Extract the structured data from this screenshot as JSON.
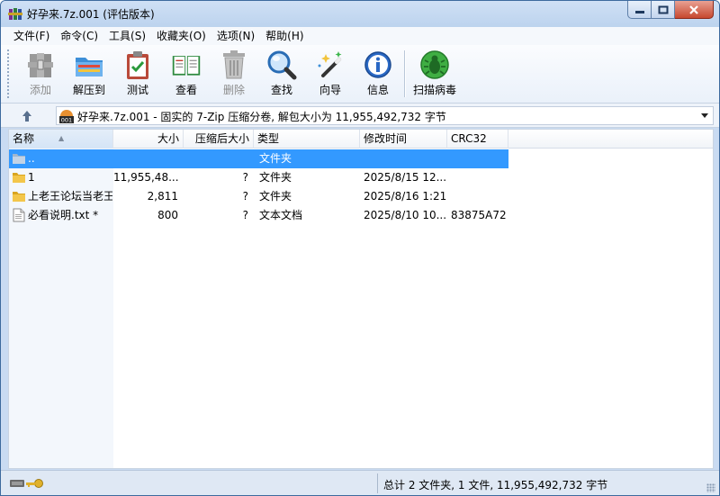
{
  "window": {
    "title": "好孕来.7z.001 (评估版本)",
    "app_icon": "winrar-books-icon",
    "controls": [
      "minimize-icon",
      "maximize-icon",
      "close-icon"
    ]
  },
  "menu": [
    {
      "label": "文件(F)"
    },
    {
      "label": "命令(C)"
    },
    {
      "label": "工具(S)"
    },
    {
      "label": "收藏夹(O)"
    },
    {
      "label": "选项(N)"
    },
    {
      "label": "帮助(H)"
    }
  ],
  "toolbar": [
    {
      "label": "添加",
      "icon": "add-archive-icon",
      "enabled": false
    },
    {
      "label": "解压到",
      "icon": "extract-folder-icon",
      "enabled": true
    },
    {
      "label": "测试",
      "icon": "test-clipboard-icon",
      "enabled": true
    },
    {
      "label": "查看",
      "icon": "view-book-icon",
      "enabled": true
    },
    {
      "label": "删除",
      "icon": "delete-trash-icon",
      "enabled": false
    },
    {
      "label": "查找",
      "icon": "find-magnifier-icon",
      "enabled": true
    },
    {
      "label": "向导",
      "icon": "wizard-wand-icon",
      "enabled": true
    },
    {
      "label": "信息",
      "icon": "info-icon",
      "enabled": true
    },
    {
      "label": "扫描病毒",
      "icon": "virus-scan-icon",
      "enabled": true
    }
  ],
  "address": {
    "text": "好孕来.7z.001 - 固实的 7-Zip 压缩分卷, 解包大小为 11,955,492,732 字节",
    "icon": "archive-001-icon"
  },
  "columns": {
    "name": "名称",
    "size": "大小",
    "packed": "压缩后大小",
    "type": "类型",
    "modified": "修改时间",
    "crc": "CRC32"
  },
  "rows": [
    {
      "name": "..",
      "size": "",
      "packed": "",
      "type": "文件夹",
      "modified": "",
      "crc": "",
      "icon": "parent-folder-icon",
      "selected": true
    },
    {
      "name": "1",
      "size": "11,955,48...",
      "packed": "?",
      "type": "文件夹",
      "modified": "2025/8/15 12...",
      "crc": "",
      "icon": "folder-icon",
      "selected": false
    },
    {
      "name": "上老王论坛当老王",
      "size": "2,811",
      "packed": "?",
      "type": "文件夹",
      "modified": "2025/8/16 1:21",
      "crc": "",
      "icon": "folder-icon",
      "selected": false
    },
    {
      "name": "必看说明.txt *",
      "size": "800",
      "packed": "?",
      "type": "文本文档",
      "modified": "2025/8/10 10...",
      "crc": "83875A72",
      "icon": "text-file-icon",
      "selected": false
    }
  ],
  "status": {
    "text": "总计 2 文件夹, 1 文件, 11,955,492,732 字节",
    "icons": [
      "drive-icon",
      "key-icon"
    ]
  }
}
